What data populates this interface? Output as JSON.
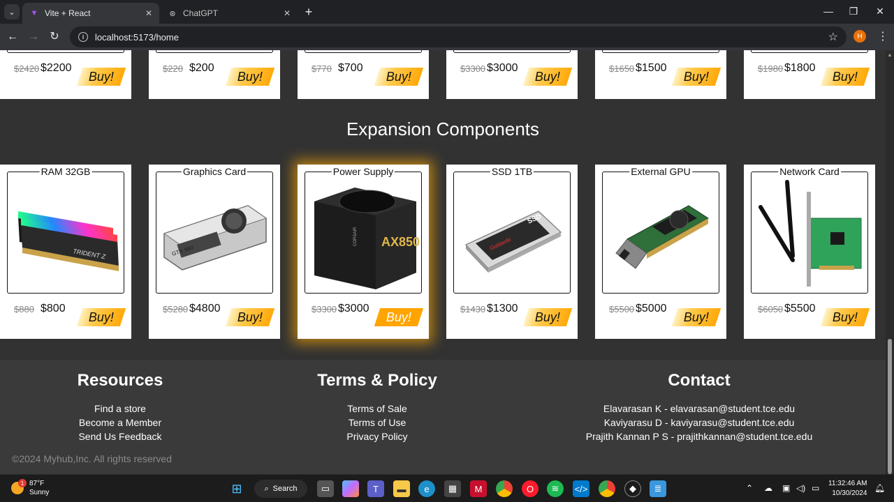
{
  "browser": {
    "tabs": [
      {
        "title": "Vite + React",
        "active": true
      },
      {
        "title": "ChatGPT",
        "active": false
      }
    ],
    "url": "localhost:5173/home",
    "profile_initial": "H"
  },
  "top_row": [
    {
      "old": "$2420",
      "new": "$2200"
    },
    {
      "old": "$220",
      "new": "$200"
    },
    {
      "old": "$770",
      "new": "$700"
    },
    {
      "old": "$3300",
      "new": "$3000"
    },
    {
      "old": "$1650",
      "new": "$1500"
    },
    {
      "old": "$1980",
      "new": "$1800"
    }
  ],
  "buy_label": "Buy!",
  "section_title": "Expansion Components",
  "products": [
    {
      "name": "RAM 32GB",
      "old": "$880",
      "new": "$800",
      "icon": "ram-icon"
    },
    {
      "name": "Graphics Card",
      "old": "$5280",
      "new": "$4800",
      "icon": "graphics-card-icon"
    },
    {
      "name": "Power Supply",
      "old": "$3300",
      "new": "$3000",
      "icon": "power-supply-icon"
    },
    {
      "name": "SSD 1TB",
      "old": "$1430",
      "new": "$1300",
      "icon": "ssd-icon"
    },
    {
      "name": "External GPU",
      "old": "$5500",
      "new": "$5000",
      "icon": "external-gpu-icon"
    },
    {
      "name": "Network Card",
      "old": "$6050",
      "new": "$5500",
      "icon": "network-card-icon"
    }
  ],
  "footer": {
    "resources": {
      "title": "Resources",
      "links": [
        "Find a store",
        "Become a Member",
        "Send Us Feedback"
      ]
    },
    "terms": {
      "title": "Terms & Policy",
      "links": [
        "Terms of Sale",
        "Terms of Use",
        "Privacy Policy"
      ]
    },
    "contact": {
      "title": "Contact",
      "links": [
        "Elavarasan K - elavarasan@student.tce.edu",
        "Kaviyarasu D - kaviyarasu@student.tce.edu",
        "Prajith Kannan P S - prajithkannan@student.tce.edu"
      ]
    },
    "copyright": "©2024 Myhub,Inc. All rights reserved"
  },
  "taskbar": {
    "weather_temp": "87°F",
    "weather_desc": "Sunny",
    "weather_badge": "1",
    "search_label": "Search",
    "time": "11:32:46 AM",
    "date": "10/30/2024"
  },
  "colors": {
    "accent": "#ffa400",
    "page_bg": "#323232",
    "footer_bg": "#3a3a3a"
  }
}
